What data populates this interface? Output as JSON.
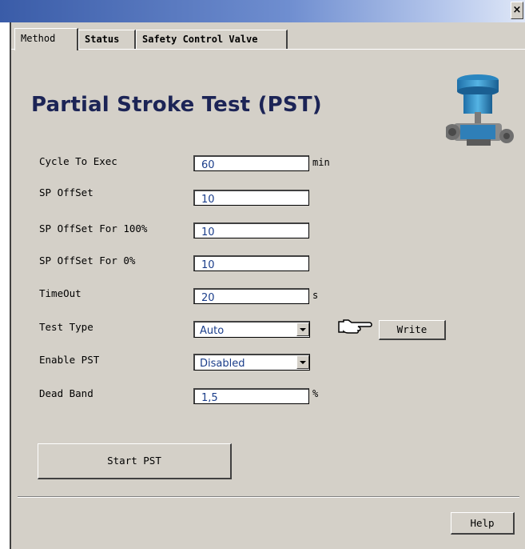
{
  "window": {
    "close_glyph": "×"
  },
  "tabs": [
    {
      "label": "Method",
      "active": true
    },
    {
      "label": "Status",
      "active": false
    },
    {
      "label": "Safety Control Valve",
      "active": false
    }
  ],
  "page": {
    "title": "Partial Stroke Test (PST)"
  },
  "fields": {
    "cycle_to_exec": {
      "label": "Cycle To Exec",
      "value": "60",
      "unit": "min"
    },
    "sp_offset": {
      "label": "SP OffSet",
      "value": "10"
    },
    "sp_offset_100": {
      "label": "SP OffSet For 100%",
      "value": "10"
    },
    "sp_offset_0": {
      "label": "SP OffSet For 0%",
      "value": "10"
    },
    "timeout": {
      "label": "TimeOut",
      "value": "20",
      "unit": "s"
    },
    "test_type": {
      "label": "Test Type",
      "value": "Auto"
    },
    "enable_pst": {
      "label": "Enable PST",
      "value": "Disabled"
    },
    "dead_band": {
      "label": "Dead Band",
      "value": "1,5",
      "unit": "%"
    }
  },
  "buttons": {
    "write": "Write",
    "start_pst": "Start PST",
    "help": "Help"
  },
  "icons": {
    "valve": "control-valve-icon",
    "hand": "pointing-hand-icon"
  },
  "colors": {
    "title": "#1c2456",
    "field_text": "#1a3d8a",
    "panel": "#d4d0c8"
  }
}
